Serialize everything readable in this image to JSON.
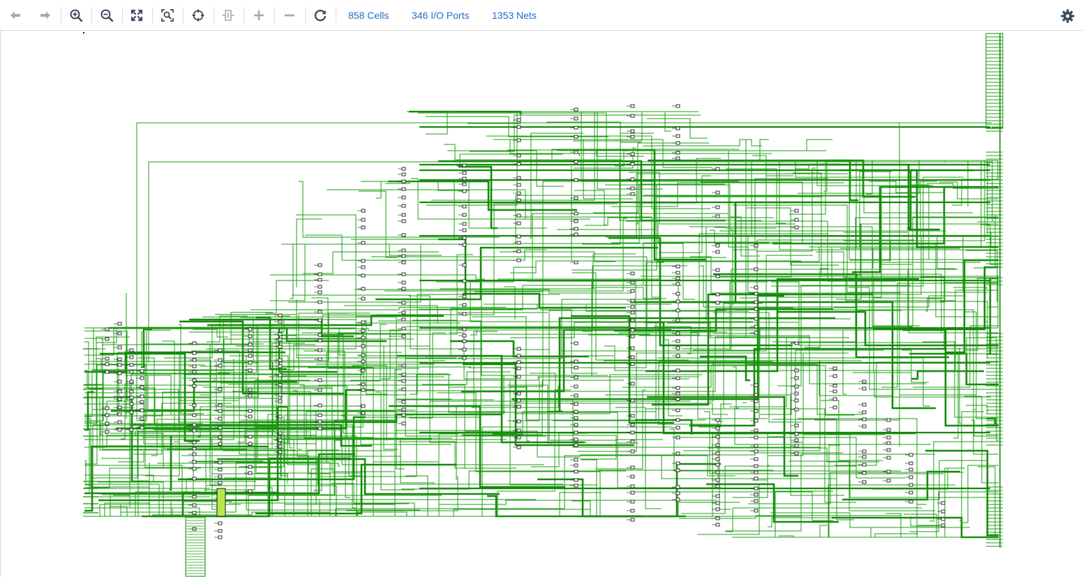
{
  "colors": {
    "link": "#1d6fc9",
    "icon_active": "#3b4a5c",
    "icon_disabled": "#a9a9a9",
    "net": "#1e9e12",
    "net_thick": "#158a0a",
    "cell": "#1a1a1a",
    "highlight": "#b7e64a"
  },
  "toolbar": {
    "back": {
      "icon": "arrow-left-icon",
      "enabled": false
    },
    "forward": {
      "icon": "arrow-right-icon",
      "enabled": false
    },
    "zoom_in": {
      "icon": "zoom-in-icon",
      "enabled": true
    },
    "zoom_out": {
      "icon": "zoom-out-icon",
      "enabled": true
    },
    "zoom_fit": {
      "icon": "fit-icon",
      "enabled": true
    },
    "zoom_selection": {
      "icon": "zoom-selection-icon",
      "enabled": true
    },
    "autofit_selection": {
      "icon": "crosshair-icon",
      "enabled": true
    },
    "collapse": {
      "icon": "collapse-icon",
      "enabled": false
    },
    "expand": {
      "icon": "plus-icon",
      "enabled": false
    },
    "remove": {
      "icon": "minus-icon",
      "enabled": false
    },
    "regenerate": {
      "icon": "refresh-icon",
      "enabled": true
    },
    "settings": {
      "icon": "gear-icon",
      "enabled": true
    }
  },
  "stats": {
    "cells": "858 Cells",
    "io_ports": "346 I/O Ports",
    "nets": "1353 Nets"
  }
}
